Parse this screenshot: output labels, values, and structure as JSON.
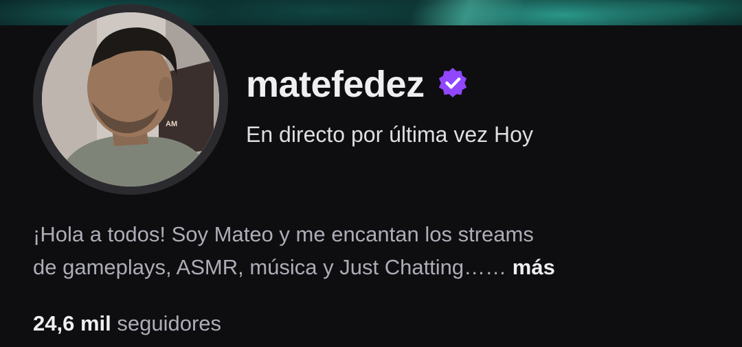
{
  "channel": {
    "name": "matefedez",
    "verified_icon": "verified-badge-icon",
    "last_live": "En directo por última vez Hoy",
    "avatar_icon": "profile-avatar",
    "avatar_watermark": "AM"
  },
  "bio": {
    "line1": "¡Hola a todos! Soy Mateo y me encantan los streams",
    "line2": "de gameplays, ASMR, música y Just Chatting……",
    "more_label": "más"
  },
  "followers": {
    "count": "24,6 mil",
    "label": "seguidores"
  },
  "colors": {
    "background": "#0e0e10",
    "accent": "#9147ff",
    "text_primary": "#efeff1",
    "text_secondary": "#adadb8"
  }
}
